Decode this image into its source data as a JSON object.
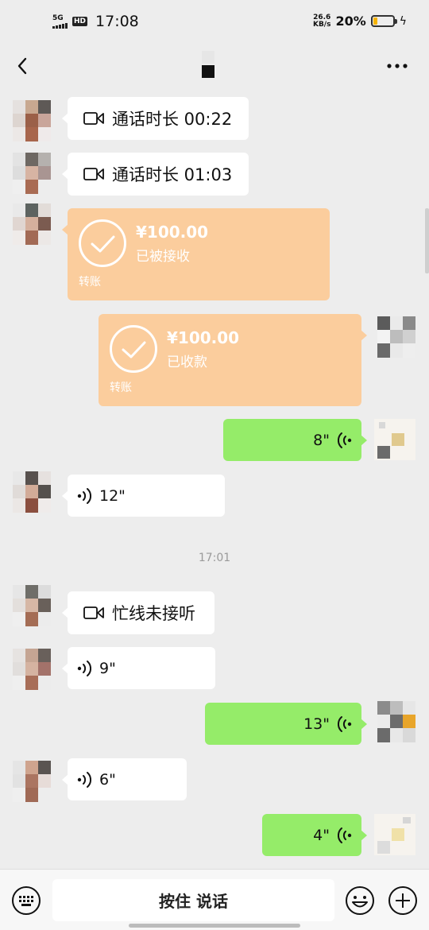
{
  "status_bar": {
    "network": "5G",
    "hd": "HD",
    "time": "17:08",
    "speed_value": "26.6",
    "speed_unit": "KB/s",
    "battery_percent": "20%",
    "battery_level": 0.2
  },
  "nav": {
    "back_icon": "chevron-left-icon",
    "more_icon": "more-dots-icon"
  },
  "messages": {
    "call_1": {
      "icon": "video-call-icon",
      "text": "通话时长 00:22"
    },
    "call_2": {
      "icon": "video-call-icon",
      "text": "通话时长 01:03"
    },
    "transfer_received": {
      "amount": "¥100.00",
      "status": "已被接收",
      "label": "转账"
    },
    "transfer_collected": {
      "amount": "¥100.00",
      "status": "已收款",
      "label": "转账"
    },
    "voice_out_1": {
      "duration": "8\""
    },
    "voice_in_1": {
      "duration": "12\""
    },
    "timestamp": "17:01",
    "call_busy": {
      "icon": "video-call-icon",
      "text": "忙线未接听"
    },
    "voice_in_2": {
      "duration": "9\""
    },
    "voice_out_2": {
      "duration": "13\""
    },
    "voice_in_3": {
      "duration": "6\""
    },
    "voice_out_3": {
      "duration": "4\""
    }
  },
  "bottom_bar": {
    "hold_to_talk": "按住 说话",
    "keyboard_icon": "keyboard-icon",
    "emoji_icon": "emoji-icon",
    "plus_icon": "plus-icon"
  },
  "colors": {
    "chat_bg": "#ededed",
    "green_bubble": "#95ec69",
    "transfer_bubble": "#fbcd9d"
  }
}
